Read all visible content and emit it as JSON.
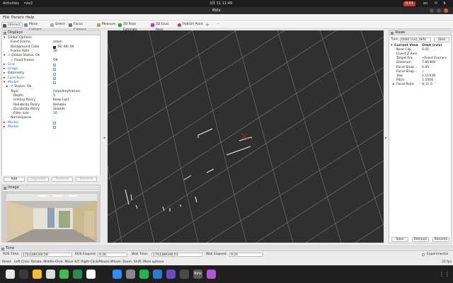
{
  "system_bar": {
    "activities": "Activities",
    "app_name": "rviz2",
    "clock": "3月 31  11:49",
    "indicator": "0.01",
    "lang": "en"
  },
  "window": {
    "title": "RViz"
  },
  "menu": {
    "file": "File",
    "panels": "Panels",
    "help": "Help"
  },
  "toolbar": {
    "interact": "Interact",
    "move_camera": "Move Camera",
    "select": "Select",
    "focus_camera": "Focus Camera",
    "measure": "Measure",
    "pose_estimate": "2D Pose Estimate",
    "goal_pose": "2D Goal Pose",
    "publish_point": "Publish Point",
    "plus": "+",
    "more": "···"
  },
  "displays": {
    "title": "Displays",
    "rows": [
      {
        "indent": 1,
        "arrow": "▾",
        "label": "Global Options",
        "value": ""
      },
      {
        "indent": 2,
        "arrow": "",
        "label": "Fixed Frame",
        "value": "odom"
      },
      {
        "indent": 2,
        "arrow": "",
        "label": "Background Color",
        "value": "48; 48; 48",
        "swatch": "#303030"
      },
      {
        "indent": 2,
        "arrow": "",
        "label": "Frame Rate",
        "value": "30"
      },
      {
        "indent": 1,
        "arrow": "▾",
        "label": "✓ Global Status: Ok",
        "value": ""
      },
      {
        "indent": 2,
        "arrow": "",
        "label": "✓ Fixed Frame",
        "value": "OK"
      },
      {
        "indent": 1,
        "arrow": "▸",
        "label": "Grid",
        "value": "",
        "check": true,
        "blue": true
      },
      {
        "indent": 1,
        "arrow": "▸",
        "label": "Image",
        "value": "",
        "check": true,
        "blue": true
      },
      {
        "indent": 1,
        "arrow": "▸",
        "label": "Odometry",
        "value": "",
        "check": false,
        "blue": false
      },
      {
        "indent": 1,
        "arrow": "▸",
        "label": "LaserScan",
        "value": "",
        "check": true,
        "blue": true
      },
      {
        "indent": 1,
        "arrow": "▾",
        "label": "Marker",
        "value": "",
        "check": true,
        "blue": true
      },
      {
        "indent": 2,
        "arrow": "▸",
        "label": "✓ Status: Ok",
        "value": ""
      },
      {
        "indent": 2,
        "arrow": "",
        "label": "Topic",
        "value": "/slam/keyframes"
      },
      {
        "indent": 3,
        "arrow": "",
        "label": "Depth",
        "value": "5"
      },
      {
        "indent": 3,
        "arrow": "",
        "label": "History Policy",
        "value": "Keep Last"
      },
      {
        "indent": 3,
        "arrow": "",
        "label": "Reliability Policy",
        "value": "Reliable"
      },
      {
        "indent": 3,
        "arrow": "",
        "label": "Durability Policy",
        "value": "Volatile"
      },
      {
        "indent": 3,
        "arrow": "",
        "label": "Filter size",
        "value": "10"
      },
      {
        "indent": 2,
        "arrow": "",
        "label": "Namespaces",
        "value": ""
      },
      {
        "indent": 1,
        "arrow": "▸",
        "label": "Marker",
        "value": "",
        "check": true,
        "blue": true
      },
      {
        "indent": 1,
        "arrow": "▸",
        "label": "Marker",
        "value": "",
        "check": true,
        "blue": true
      }
    ],
    "buttons": {
      "add": "Add",
      "duplicate": "Duplicate",
      "remove": "Remove",
      "rename": "Rename"
    }
  },
  "image_panel": {
    "title": "Image"
  },
  "views": {
    "title": "Views",
    "type_label": "Type:",
    "type_value": "Orbit (rviz_defa",
    "zero": "Zero",
    "rows": [
      {
        "indent": 1,
        "arrow": "▾",
        "label": "Current View",
        "value": "Orbit (rviz)",
        "bold": true
      },
      {
        "indent": 2,
        "arrow": "",
        "label": "Near Clip ...",
        "value": "0.01"
      },
      {
        "indent": 2,
        "arrow": "",
        "label": "Invert Z Axis",
        "value": ""
      },
      {
        "indent": 2,
        "arrow": "",
        "label": "Target Fra...",
        "value": "<Fixed Frame>"
      },
      {
        "indent": 2,
        "arrow": "",
        "label": "Distance",
        "value": "7.81469"
      },
      {
        "indent": 2,
        "arrow": "",
        "label": "Focal Shap...",
        "value": "0.05"
      },
      {
        "indent": 2,
        "arrow": "",
        "label": "Focal Shap...",
        "value": "✓"
      },
      {
        "indent": 2,
        "arrow": "",
        "label": "Yaw",
        "value": "1.11039"
      },
      {
        "indent": 2,
        "arrow": "",
        "label": "Pitch",
        "value": "1.1004"
      },
      {
        "indent": 2,
        "arrow": "▸",
        "label": "Focal Point",
        "value": "0; 0; 0"
      }
    ],
    "buttons": {
      "save": "Save",
      "remove": "Remove",
      "rename": "Rename"
    }
  },
  "time": {
    "title": "Time",
    "ros_time_label": "ROS Time:",
    "ros_time": "1743389346.58",
    "ros_elapsed_label": "ROS Elapsed:",
    "ros_elapsed": "9.26",
    "wall_time_label": "Wall Time:",
    "wall_time": "1743389346.61",
    "wall_elapsed_label": "Wall Elapsed:",
    "wall_elapsed": "9.24",
    "experimental": "Experimental"
  },
  "status": {
    "reset": "Reset",
    "hint": "Left-Click: Rotate. Middle-Click: Move X/Y. Right-Click/Mouse Wheel: Zoom. Shift: More options.",
    "fps": "31 fps"
  },
  "dock": {
    "apps": [
      {
        "name": "files-app-icon",
        "color": "#e8e8e8"
      },
      {
        "name": "terminal-app-icon",
        "color": "#3a3a3a"
      },
      {
        "name": "chrome-app-icon",
        "color": "#f3c02b"
      },
      {
        "name": "slack-app-icon",
        "color": "#dcdcdc"
      },
      {
        "name": "wechat-app-icon",
        "color": "#3bbf4f"
      },
      {
        "name": "store-app-icon",
        "color": "#2d8c4e"
      },
      {
        "name": "chatgpt-app-icon",
        "color": "#ffffff"
      },
      {
        "name": "zoom-app-icon",
        "color": "#2d8cff"
      },
      {
        "name": "settings-app-icon",
        "color": "#888888"
      },
      {
        "name": "spotify-app-icon",
        "color": "#1db954"
      },
      {
        "name": "vscode-app-icon",
        "color": "#2a7bd3"
      },
      {
        "name": "mail-app-icon",
        "color": "#6b4bc7"
      },
      {
        "name": "camera-app-icon",
        "color": "#4a4a4a"
      },
      {
        "name": "rviz-app-icon",
        "color": "#5a5a5a"
      },
      {
        "name": "screenshot-app-icon",
        "color": "#b455d4"
      },
      {
        "name": "show-apps-icon",
        "color": "#1f1f1f"
      }
    ],
    "rviz_label": "RViz"
  }
}
